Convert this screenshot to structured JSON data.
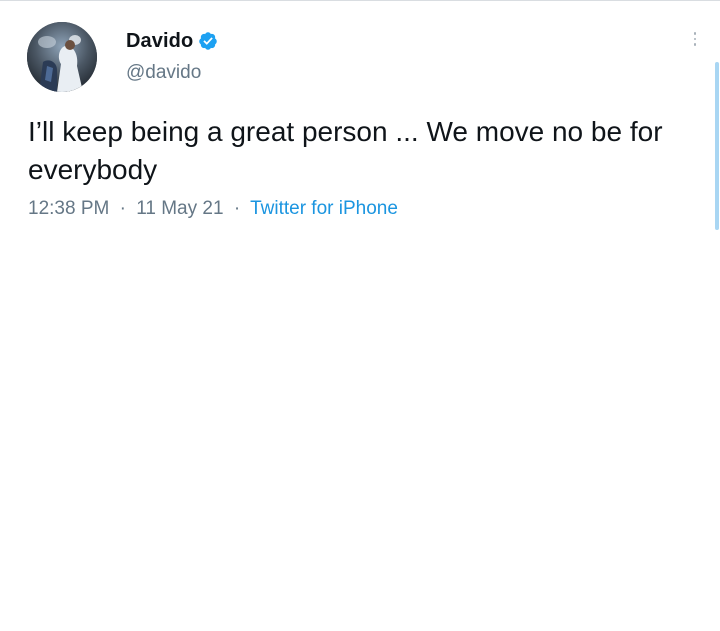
{
  "tweet": {
    "author": {
      "display_name": "Davido",
      "handle": "@davido",
      "verified": true,
      "avatar_icon": "profile-photo"
    },
    "text": "I’ll keep being a great person ... We move no be for everybody",
    "time": "12:38 PM",
    "date": "11 May 21",
    "separator": "·",
    "source": "Twitter for iPhone",
    "menu_icon": "more-vertical-icon"
  },
  "colors": {
    "primary_text": "#0f1419",
    "secondary_text": "#657786",
    "link": "#1b95e0",
    "verified_badge": "#1da1f2"
  }
}
